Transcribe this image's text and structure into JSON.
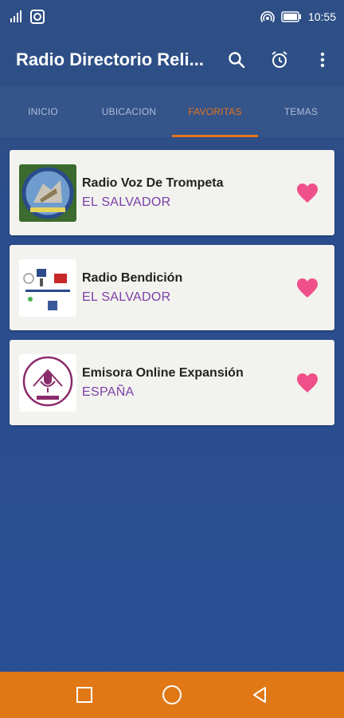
{
  "status_bar": {
    "time": "10:55"
  },
  "app_bar": {
    "title": "Radio Directorio Reli...",
    "actions": [
      "search-icon",
      "alarm-icon",
      "more-vert-icon"
    ]
  },
  "tabs": [
    {
      "label": "INICIO",
      "active": false
    },
    {
      "label": "UBICACION",
      "active": false
    },
    {
      "label": "FAVORITAS",
      "active": true
    },
    {
      "label": "TEMAS",
      "active": false
    }
  ],
  "favorites": [
    {
      "name": "Radio Voz De Trompeta",
      "country": "EL SALVADOR",
      "logo": "trompeta-logo"
    },
    {
      "name": "Radio Bendición",
      "country": "EL SALVADOR",
      "logo": "bendicion-logo"
    },
    {
      "name": "Emisora Online Expansión",
      "country": "ESPAÑA",
      "logo": "expansion-logo"
    }
  ],
  "colors": {
    "primary": "#2e4f86",
    "accent": "#e8731d",
    "heart": "#f0508a",
    "country": "#7b3fa8",
    "nav_bar": "#e07816"
  }
}
